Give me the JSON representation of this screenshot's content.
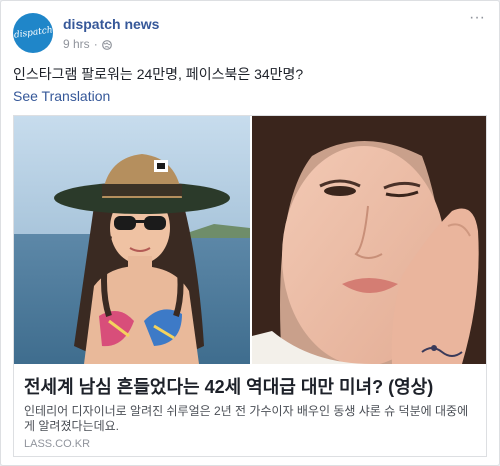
{
  "post": {
    "page_name": "dispatch news",
    "avatar_text": "dispatch",
    "timestamp": "9 hrs",
    "separator": "·",
    "privacy_icon": "globe-icon",
    "more_icon": "more-dots-icon",
    "more_label": "···",
    "text": "인스타그램 팔로워는 24만명, 페이스북은 34만명?",
    "see_translation": "See Translation"
  },
  "link_card": {
    "left_image": "woman-in-bikini-and-straw-hat-photo",
    "right_image": "woman-resting-face-on-hand-photo",
    "title": "전세계 남심 흔들었다는 42세 역대급 대만 미녀? (영상)",
    "description": "인테리어 디자이너로 알려진 쉬루얼은 2년 전 가수이자 배우인 동생 샤론 슈 덕분에 대중에게 알려졌다는데요.",
    "domain": "LASS.CO.KR"
  },
  "colors": {
    "link_blue": "#365899",
    "text_dark": "#1d2129",
    "meta_gray": "#90949c",
    "avatar_blue": "#1f86c9"
  }
}
